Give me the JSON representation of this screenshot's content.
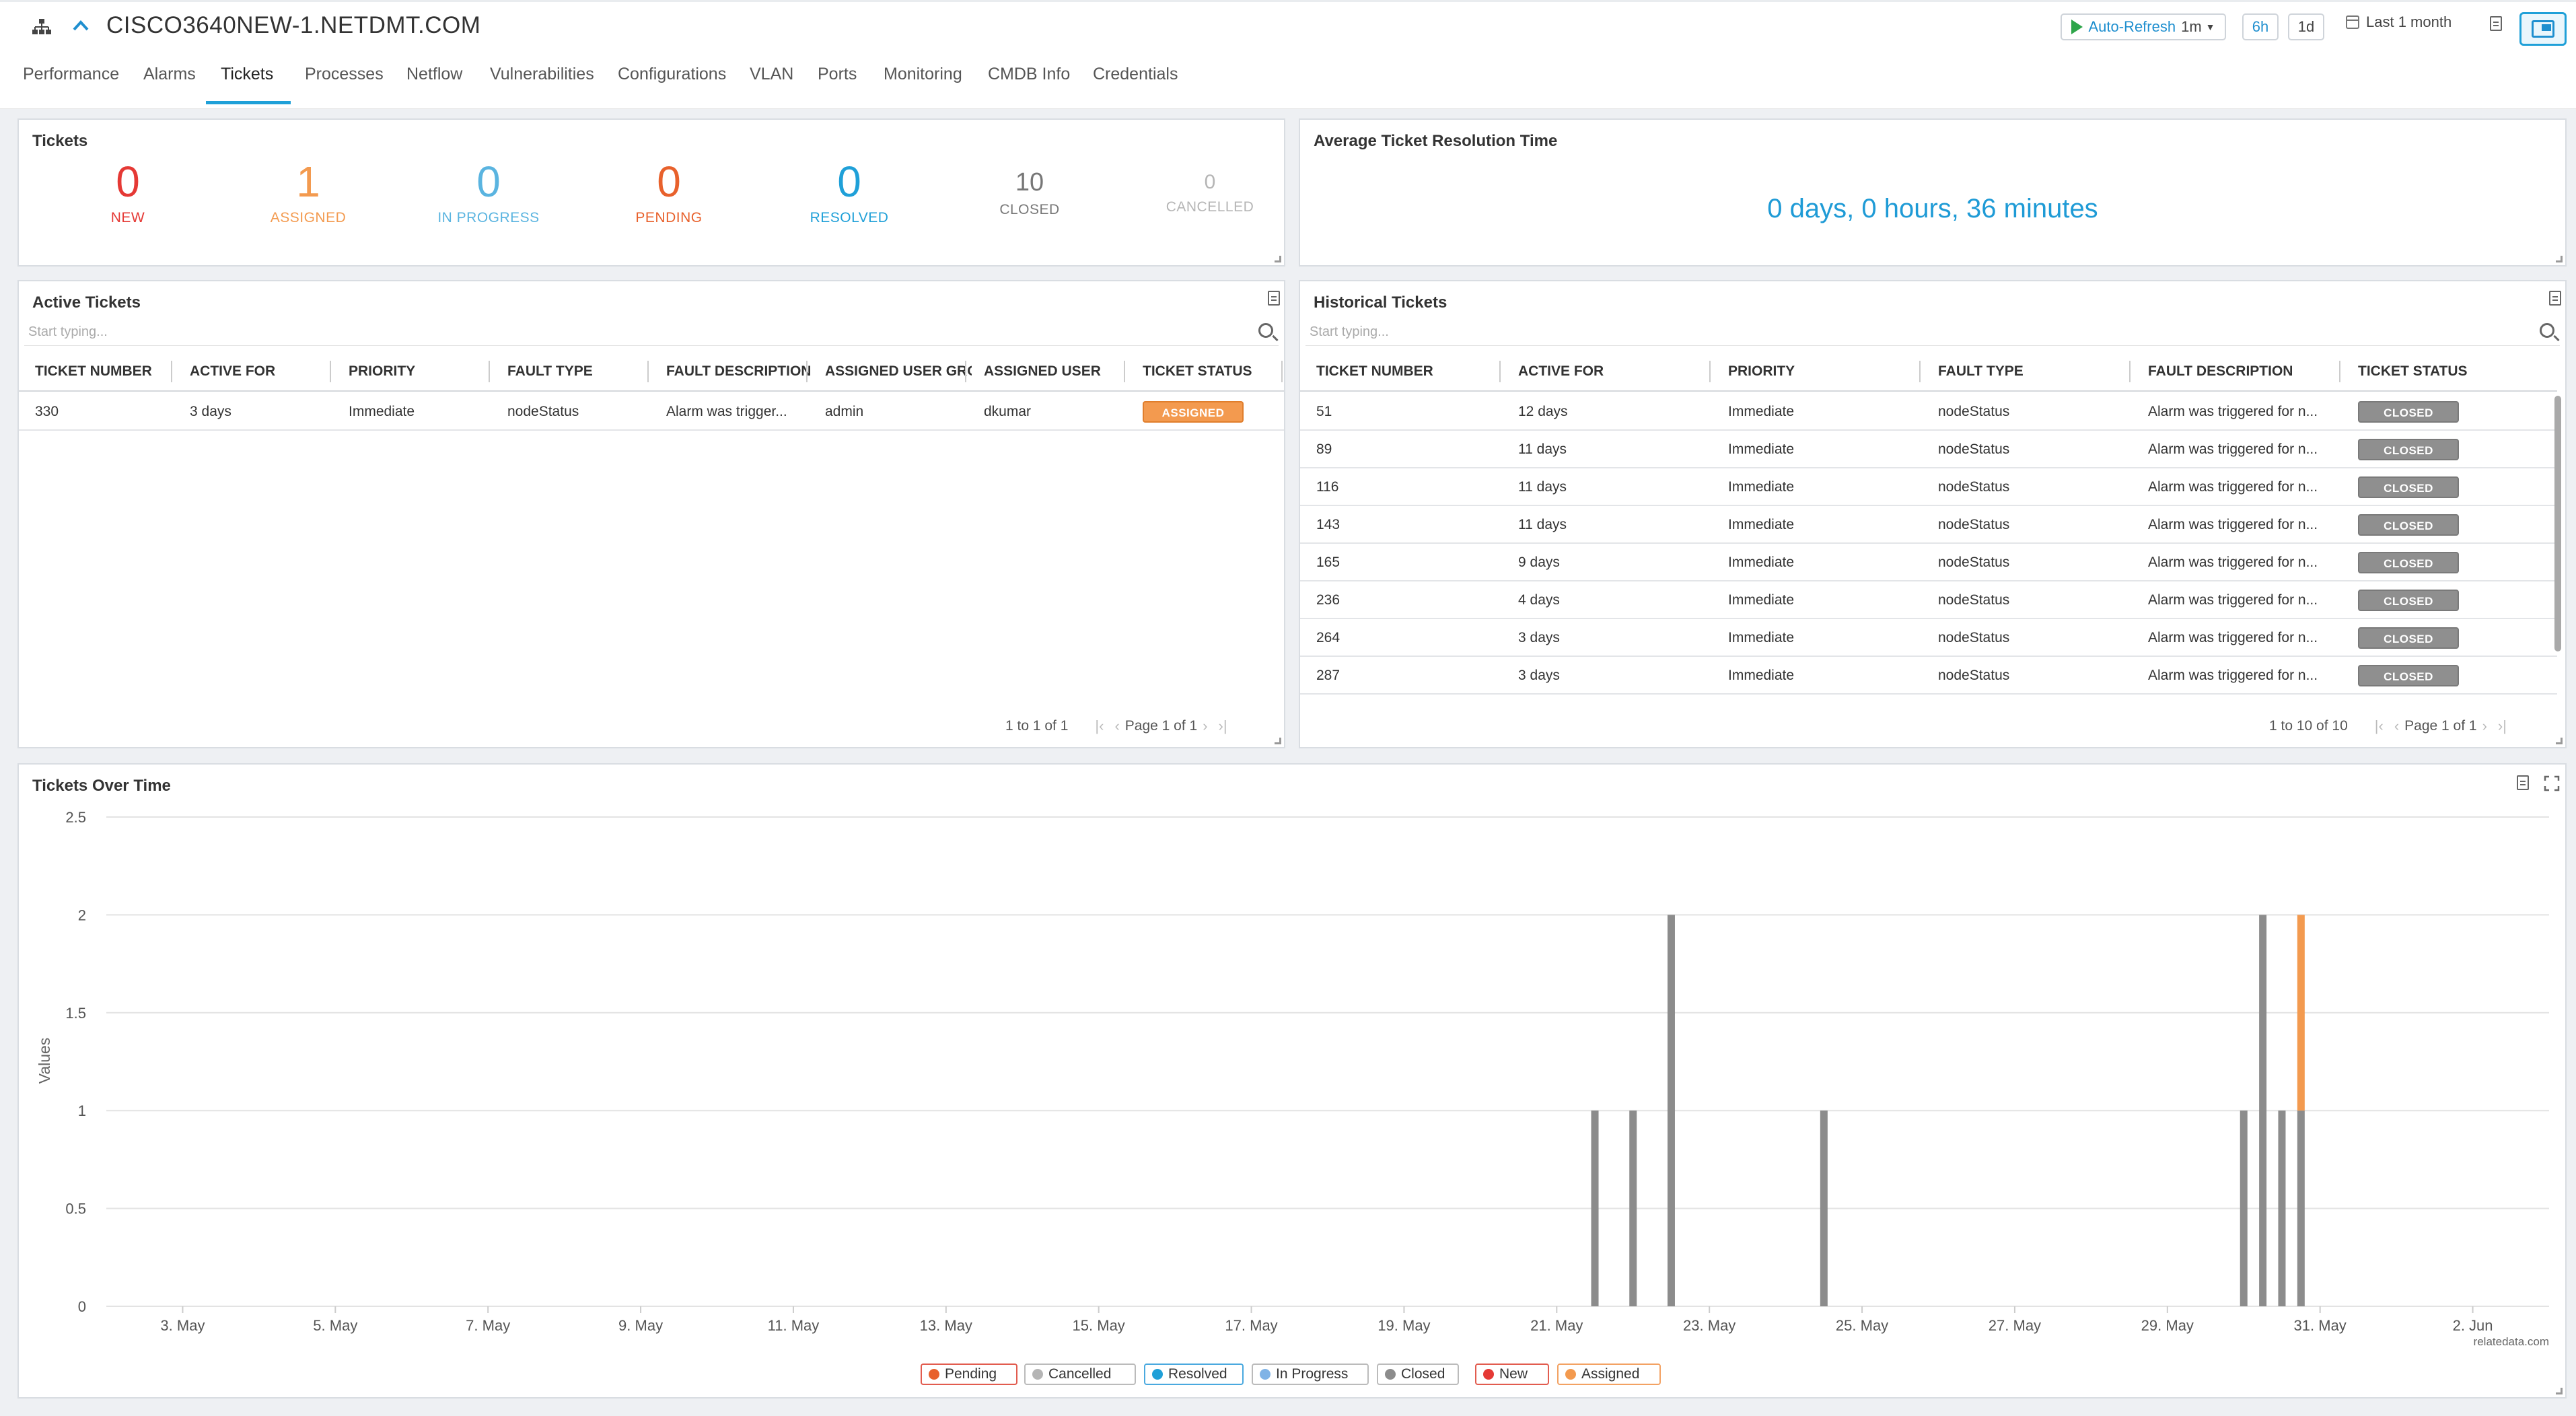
{
  "header": {
    "title": "CISCO3640NEW-1.NETDMT.COM",
    "auto_refresh_label": "Auto-Refresh",
    "auto_refresh_interval": "1m",
    "range_6h": "6h",
    "range_1d": "1d",
    "time_range": "Last 1 month"
  },
  "tabs": [
    {
      "label": "Performance"
    },
    {
      "label": "Alarms"
    },
    {
      "label": "Tickets"
    },
    {
      "label": "Processes"
    },
    {
      "label": "Netflow"
    },
    {
      "label": "Vulnerabilities"
    },
    {
      "label": "Configurations"
    },
    {
      "label": "VLAN"
    },
    {
      "label": "Ports"
    },
    {
      "label": "Monitoring"
    },
    {
      "label": "CMDB Info"
    },
    {
      "label": "Credentials"
    }
  ],
  "active_tab": "Tickets",
  "tickets_panel": {
    "title": "Tickets",
    "stats": [
      {
        "value": "0",
        "label": "NEW",
        "color": "#e53935"
      },
      {
        "value": "1",
        "label": "ASSIGNED",
        "color": "#f39a4f"
      },
      {
        "value": "0",
        "label": "IN PROGRESS",
        "color": "#5ab4e0"
      },
      {
        "value": "0",
        "label": "PENDING",
        "color": "#e8612c"
      },
      {
        "value": "0",
        "label": "RESOLVED",
        "color": "#1fa0d8"
      },
      {
        "value": "10",
        "label": "CLOSED",
        "color": "#777777"
      },
      {
        "value": "0",
        "label": "CANCELLED",
        "color": "#b5b5b5"
      }
    ]
  },
  "resolution_panel": {
    "title": "Average Ticket Resolution Time",
    "value": "0 days, 0 hours, 36 minutes"
  },
  "active_tickets": {
    "title": "Active Tickets",
    "search_placeholder": "Start typing...",
    "columns": [
      "TICKET NUMBER",
      "ACTIVE FOR",
      "PRIORITY",
      "FAULT TYPE",
      "FAULT DESCRIPTION",
      "ASSIGNED USER GRO",
      "ASSIGNED USER",
      "TICKET STATUS"
    ],
    "rows": [
      {
        "number": "330",
        "active_for": "3 days",
        "priority": "Immediate",
        "fault_type": "nodeStatus",
        "fault_description": "Alarm was trigger...",
        "user_group": "admin",
        "user": "dkumar",
        "status": "ASSIGNED"
      }
    ],
    "range_text": "1 to 1 of 1",
    "page_text": "Page 1 of 1"
  },
  "historical_tickets": {
    "title": "Historical Tickets",
    "search_placeholder": "Start typing...",
    "columns": [
      "TICKET NUMBER",
      "ACTIVE FOR",
      "PRIORITY",
      "FAULT TYPE",
      "FAULT DESCRIPTION",
      "TICKET STATUS"
    ],
    "rows": [
      {
        "number": "51",
        "active_for": "12 days",
        "priority": "Immediate",
        "fault_type": "nodeStatus",
        "fault_description": "Alarm was triggered for n...",
        "status": "CLOSED"
      },
      {
        "number": "89",
        "active_for": "11 days",
        "priority": "Immediate",
        "fault_type": "nodeStatus",
        "fault_description": "Alarm was triggered for n...",
        "status": "CLOSED"
      },
      {
        "number": "116",
        "active_for": "11 days",
        "priority": "Immediate",
        "fault_type": "nodeStatus",
        "fault_description": "Alarm was triggered for n...",
        "status": "CLOSED"
      },
      {
        "number": "143",
        "active_for": "11 days",
        "priority": "Immediate",
        "fault_type": "nodeStatus",
        "fault_description": "Alarm was triggered for n...",
        "status": "CLOSED"
      },
      {
        "number": "165",
        "active_for": "9 days",
        "priority": "Immediate",
        "fault_type": "nodeStatus",
        "fault_description": "Alarm was triggered for n...",
        "status": "CLOSED"
      },
      {
        "number": "236",
        "active_for": "4 days",
        "priority": "Immediate",
        "fault_type": "nodeStatus",
        "fault_description": "Alarm was triggered for n...",
        "status": "CLOSED"
      },
      {
        "number": "264",
        "active_for": "3 days",
        "priority": "Immediate",
        "fault_type": "nodeStatus",
        "fault_description": "Alarm was triggered for n...",
        "status": "CLOSED"
      },
      {
        "number": "287",
        "active_for": "3 days",
        "priority": "Immediate",
        "fault_type": "nodeStatus",
        "fault_description": "Alarm was triggered for n...",
        "status": "CLOSED"
      }
    ],
    "range_text": "1 to 10 of 10",
    "page_text": "Page 1 of 1"
  },
  "chart_panel": {
    "title": "Tickets Over Time",
    "credit": "relatedata.com"
  },
  "chart_data": {
    "type": "bar",
    "stacked": true,
    "title": "Tickets Over Time",
    "xlabel": "",
    "ylabel": "Values",
    "ylim": [
      0,
      2.5
    ],
    "yticks": [
      "0",
      "0.5",
      "1",
      "1.5",
      "2",
      "2.5"
    ],
    "xlim": [
      "2024-05-02",
      "2024-06-03"
    ],
    "xticks": [
      "3. May",
      "5. May",
      "7. May",
      "9. May",
      "11. May",
      "13. May",
      "15. May",
      "17. May",
      "19. May",
      "21. May",
      "23. May",
      "25. May",
      "27. May",
      "29. May",
      "31. May",
      "2. Jun"
    ],
    "grid": true,
    "legend_position": "bottom",
    "series": [
      {
        "name": "Pending",
        "color": "#e8612c",
        "values": []
      },
      {
        "name": "Cancelled",
        "color": "#b5b5b5",
        "values": []
      },
      {
        "name": "Resolved",
        "color": "#1fa0d8",
        "values": []
      },
      {
        "name": "In Progress",
        "color": "#7fb3e6",
        "values": []
      },
      {
        "name": "Closed",
        "color": "#8c8c8c",
        "values": [
          {
            "x": "2024-05-21 12:00",
            "y": 1
          },
          {
            "x": "2024-05-22 00:00",
            "y": 1
          },
          {
            "x": "2024-05-22 12:00",
            "y": 2
          },
          {
            "x": "2024-05-24 12:00",
            "y": 1
          },
          {
            "x": "2024-05-30 00:00",
            "y": 1
          },
          {
            "x": "2024-05-30 06:00",
            "y": 2
          },
          {
            "x": "2024-05-30 12:00",
            "y": 1
          },
          {
            "x": "2024-05-30 18:00",
            "y": 1
          }
        ]
      },
      {
        "name": "New",
        "color": "#e53935",
        "values": []
      },
      {
        "name": "Assigned",
        "color": "#f39a4f",
        "values": [
          {
            "x": "2024-05-30 18:00",
            "y": 1
          }
        ]
      }
    ]
  }
}
